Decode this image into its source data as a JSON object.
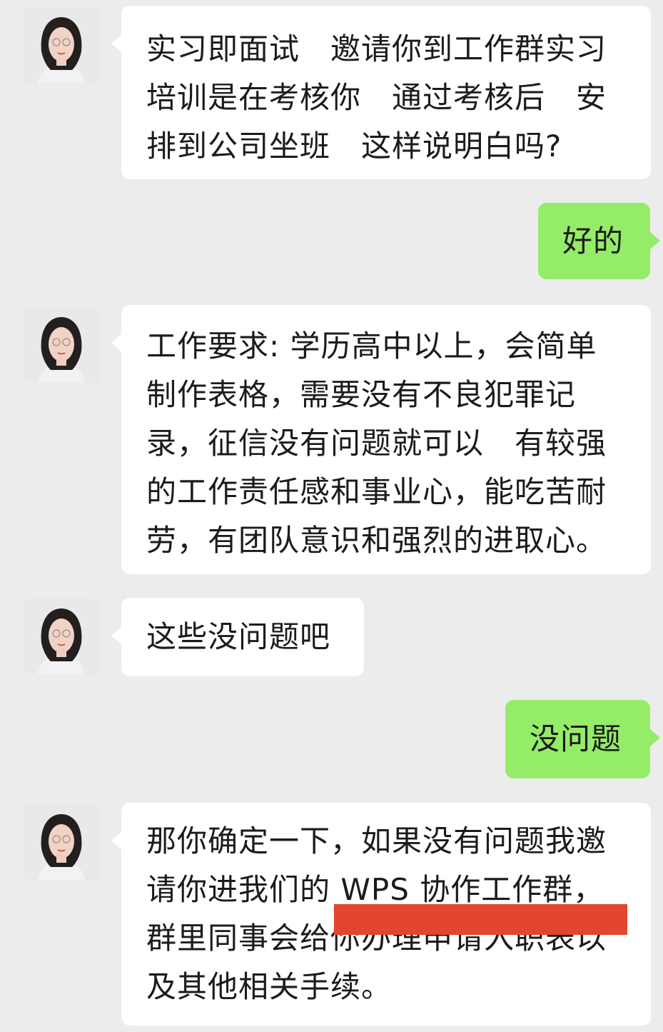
{
  "messages": [
    {
      "side": "received",
      "lines": [
        "实习即面试　邀请你到工作群实习",
        "培训是在考核你　通过考核后　安",
        "排到公司坐班　这样说明白吗?"
      ]
    },
    {
      "side": "sent",
      "lines": [
        "好的"
      ]
    },
    {
      "side": "received",
      "lines": [
        "工作要求: 学历高中以上，会简单",
        "制作表格，需要没有不良犯罪记",
        "录，征信没有问题就可以　有较强",
        "的工作责任感和事业心，能吃苦耐",
        "劳，有团队意识和强烈的进取心。"
      ]
    },
    {
      "side": "received",
      "lines": [
        "这些没问题吧"
      ]
    },
    {
      "side": "sent",
      "lines": [
        "没问题"
      ]
    },
    {
      "side": "received",
      "lines": [
        "那你确定一下，如果没有问题我邀",
        "请你进我们的 WPS 协作工作群，",
        "群里同事会给你办理申请入职表以",
        "及其他相关手续。"
      ]
    }
  ],
  "colors": {
    "background": "#ececec",
    "received_bubble": "#ffffff",
    "sent_bubble": "#95ec69",
    "redaction": "#e2462e"
  }
}
